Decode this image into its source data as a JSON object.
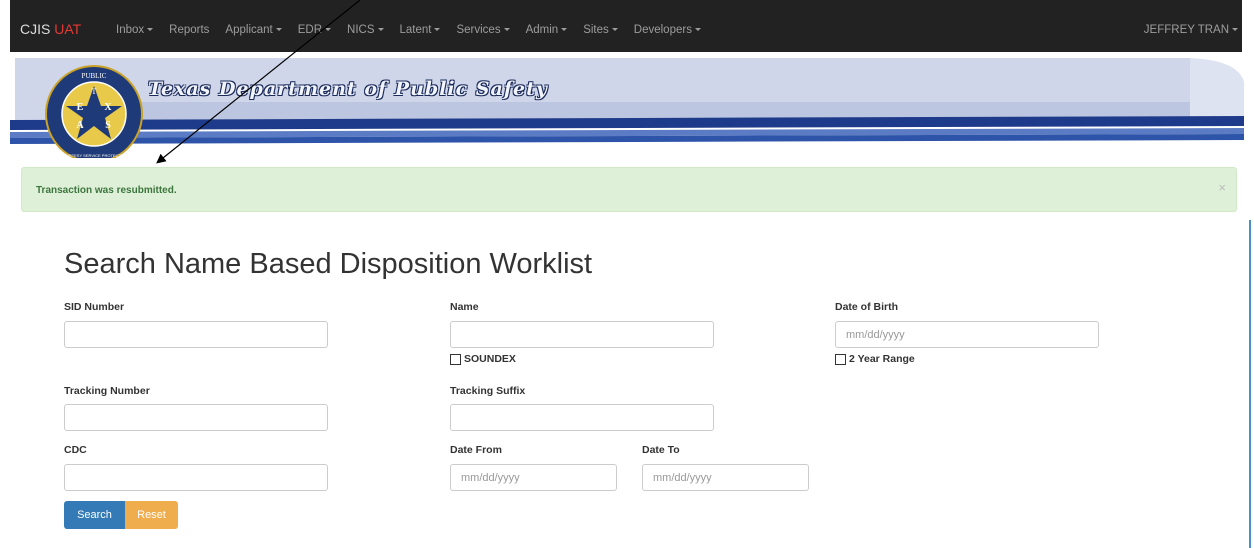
{
  "navbar": {
    "brand": "CJIS",
    "brand_env": "UAT",
    "items": [
      {
        "label": "Inbox",
        "dropdown": true
      },
      {
        "label": "Reports",
        "dropdown": false
      },
      {
        "label": "Applicant",
        "dropdown": true
      },
      {
        "label": "EDR",
        "dropdown": true
      },
      {
        "label": "NICS",
        "dropdown": true
      },
      {
        "label": "Latent",
        "dropdown": true
      },
      {
        "label": "Services",
        "dropdown": true
      },
      {
        "label": "Admin",
        "dropdown": true
      },
      {
        "label": "Sites",
        "dropdown": true
      },
      {
        "label": "Developers",
        "dropdown": true
      }
    ],
    "user": "JEFFREY TRAN"
  },
  "banner": {
    "title": "Texas Department of Public Safety",
    "seal": {
      "top": "PUBLIC",
      "left": "DEPARTMENT OF",
      "right": "SAFETY",
      "bottom": "COURTESY SERVICE PROTECTION",
      "letters": [
        "T",
        "E",
        "X",
        "A",
        "S"
      ]
    }
  },
  "alert": {
    "message": "Transaction was resubmitted.",
    "close": "×"
  },
  "form": {
    "title": "Search Name Based Disposition Worklist",
    "sid_label": "SID Number",
    "sid_value": "",
    "name_label": "Name",
    "name_value": "",
    "soundex_label": "SOUNDEX",
    "dob_label": "Date of Birth",
    "dob_placeholder": "mm/dd/yyyy",
    "two_year_label": "2 Year Range",
    "tracking_number_label": "Tracking Number",
    "tracking_number_value": "",
    "tracking_suffix_label": "Tracking Suffix",
    "tracking_suffix_value": "",
    "cdc_label": "CDC",
    "cdc_value": "",
    "date_from_label": "Date From",
    "date_from_placeholder": "mm/dd/yyyy",
    "date_to_label": "Date To",
    "date_to_placeholder": "mm/dd/yyyy",
    "search_button": "Search",
    "reset_button": "Reset"
  },
  "colors": {
    "navbar_bg": "#222222",
    "alert_bg": "#dff0d8",
    "alert_text": "#3c763d",
    "primary": "#337ab7",
    "warning": "#f0ad4e",
    "brand_env": "#e53935"
  }
}
